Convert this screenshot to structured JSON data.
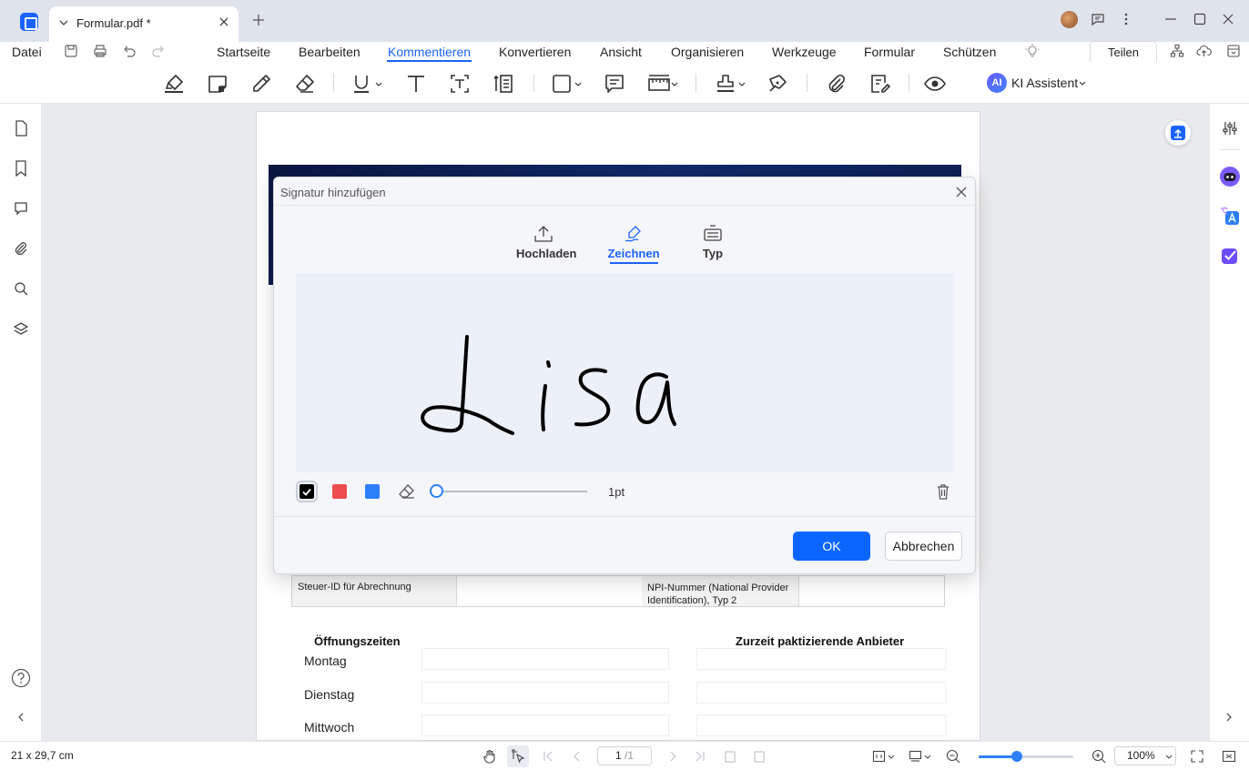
{
  "titlebar": {
    "tab_title": "Formular.pdf *"
  },
  "menu": {
    "file": "Datei",
    "items": [
      "Startseite",
      "Bearbeiten",
      "Kommentieren",
      "Konvertieren",
      "Ansicht",
      "Organisieren",
      "Werkzeuge",
      "Formular",
      "Schützen"
    ],
    "active": "Kommentieren",
    "share": "Teilen"
  },
  "toolbar": {
    "ai_badge": "AI",
    "ai_label": "KI Assistent"
  },
  "document": {
    "table": {
      "tax_label": "Steuer-ID für Abrechnung",
      "npi_label": "NPI-Nummer (National Provider Identification), Typ 2"
    },
    "hours_title": "Öffnungszeiten",
    "providers_title": "Zurzeit paktizierende Anbieter",
    "days": [
      "Montag",
      "Dienstag",
      "Mittwoch"
    ]
  },
  "dialog": {
    "title": "Signatur hinzufügen",
    "modes": [
      "Hochladen",
      "Zeichnen",
      "Typ"
    ],
    "active_mode": "Zeichnen",
    "colors": [
      "#000000",
      "#ee4d4d",
      "#2d7ff9"
    ],
    "selected_color": "#000000",
    "stroke_width": "1pt",
    "ok": "OK",
    "cancel": "Abbrechen"
  },
  "status": {
    "page_size": "21 x 29,7 cm",
    "page_current": "1",
    "page_total": "/1",
    "zoom": "100%",
    "zoom_level": 0.4
  }
}
